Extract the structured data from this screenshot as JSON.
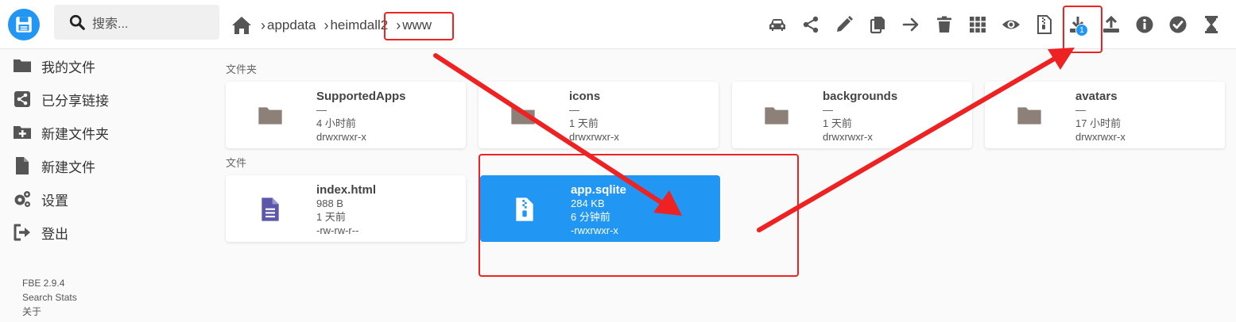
{
  "header": {
    "search_placeholder": "搜索...",
    "breadcrumbs": [
      "appdata",
      "heimdall2",
      "www"
    ],
    "download_badge": "1"
  },
  "toolbar": {
    "icons": [
      "car-icon",
      "share-icon",
      "pencil-icon",
      "copy-icon",
      "arrow-right-icon",
      "trash-icon",
      "grid-icon",
      "eye-icon",
      "file-archive-icon",
      "download-icon",
      "upload-icon",
      "info-icon",
      "check-circle-icon",
      "hourglass-icon"
    ]
  },
  "sidebar": {
    "items": [
      {
        "label": "我的文件",
        "icon": "folder-icon"
      },
      {
        "label": "已分享链接",
        "icon": "share-square-icon"
      },
      {
        "label": "新建文件夹",
        "icon": "folder-plus-icon"
      },
      {
        "label": "新建文件",
        "icon": "file-icon"
      },
      {
        "label": "设置",
        "icon": "cogs-icon"
      },
      {
        "label": "登出",
        "icon": "sign-out-icon"
      }
    ],
    "footer": {
      "version": "FBE 2.9.4",
      "search_stats": "Search Stats",
      "about": "关于"
    }
  },
  "main": {
    "folders_title": "文件夹",
    "files_title": "文件",
    "folders": [
      {
        "name": "SupportedApps",
        "size": "—",
        "modified": "4 小时前",
        "perms": "drwxrwxr-x"
      },
      {
        "name": "icons",
        "size": "—",
        "modified": "1 天前",
        "perms": "drwxrwxr-x"
      },
      {
        "name": "backgrounds",
        "size": "—",
        "modified": "1 天前",
        "perms": "drwxrwxr-x"
      },
      {
        "name": "avatars",
        "size": "—",
        "modified": "17 小时前",
        "perms": "drwxrwxr-x"
      }
    ],
    "files": [
      {
        "name": "index.html",
        "size": "988 B",
        "modified": "1 天前",
        "perms": "-rw-rw-r--"
      },
      {
        "name": "app.sqlite",
        "size": "284 KB",
        "modified": "6 分钟前",
        "perms": "-rwxrwxr-x",
        "selected": true
      }
    ]
  },
  "colors": {
    "accent": "#2196f3",
    "folder_icon": "#8d8079",
    "file_icon": "#5c57a8",
    "annotation": "#ee2222"
  }
}
